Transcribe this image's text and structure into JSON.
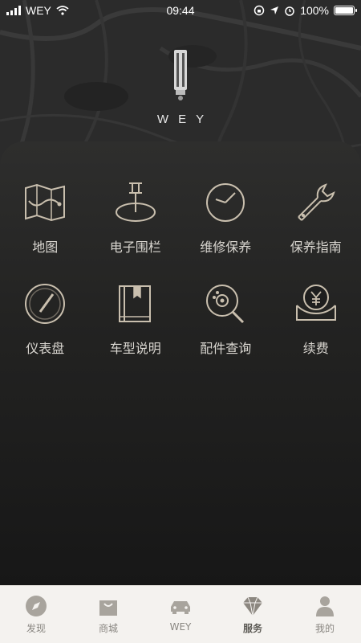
{
  "status_bar": {
    "carrier": "WEY",
    "time": "09:44",
    "battery": "100%",
    "battery_level": 1.0
  },
  "brand": {
    "logo_text": "WEY"
  },
  "services": [
    {
      "label": "地图",
      "icon": "map-icon"
    },
    {
      "label": "电子围栏",
      "icon": "geofence-pin-icon"
    },
    {
      "label": "维修保养",
      "icon": "clock-icon"
    },
    {
      "label": "保养指南",
      "icon": "wrench-icon"
    },
    {
      "label": "仪表盘",
      "icon": "gauge-icon"
    },
    {
      "label": "车型说明",
      "icon": "manual-book-icon"
    },
    {
      "label": "配件查询",
      "icon": "parts-search-icon"
    },
    {
      "label": "续费",
      "icon": "yen-payment-icon"
    }
  ],
  "tabbar": {
    "active": "服务",
    "items": [
      {
        "label": "发现",
        "icon": "compass-icon"
      },
      {
        "label": "商城",
        "icon": "shopping-bag-icon"
      },
      {
        "label": "WEY",
        "icon": "car-icon"
      },
      {
        "label": "服务",
        "icon": "diamond-icon"
      },
      {
        "label": "我的",
        "icon": "person-icon"
      }
    ]
  },
  "colors": {
    "icon_stroke": "#c9bfae",
    "panel_top": "#2e2e2d",
    "tab_bg": "#f4f2ef",
    "tab_icon": "#a8a49d"
  }
}
